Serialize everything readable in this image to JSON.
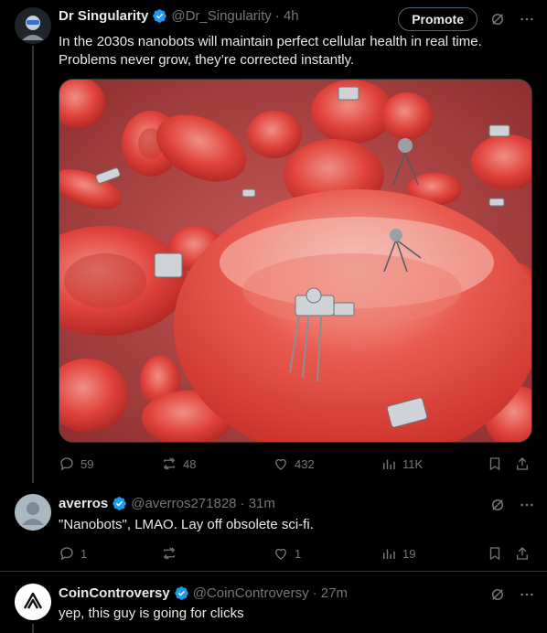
{
  "tweet1": {
    "name": "Dr Singularity",
    "handle": "@Dr_Singularity",
    "time": "· 4h",
    "promote_label": "Promote",
    "text": "In the 2030s nanobots will maintain perfect cellular health in real time. Problems never grow, they’re corrected instantly.",
    "stats": {
      "replies": "59",
      "reposts": "48",
      "likes": "432",
      "views": "11K"
    },
    "media_icon": "red-blood-cells-with-nanobots-illustration"
  },
  "tweet2": {
    "name": "averros",
    "handle": "@averros271828",
    "time": "· 31m",
    "text": "\"Nanobots\", LMAO.  Lay off obsolete sci-fi.",
    "stats": {
      "replies": "1",
      "reposts": "",
      "likes": "1",
      "views": "19"
    }
  },
  "tweet3": {
    "name": "CoinControversy",
    "handle": "@CoinControversy",
    "time": "· 27m",
    "text": "yep, this guy is going for clicks"
  },
  "colors": {
    "verified": "#1d9bf0",
    "muted": "#71767b",
    "text": "#e7e9ea",
    "background": "#000000"
  }
}
